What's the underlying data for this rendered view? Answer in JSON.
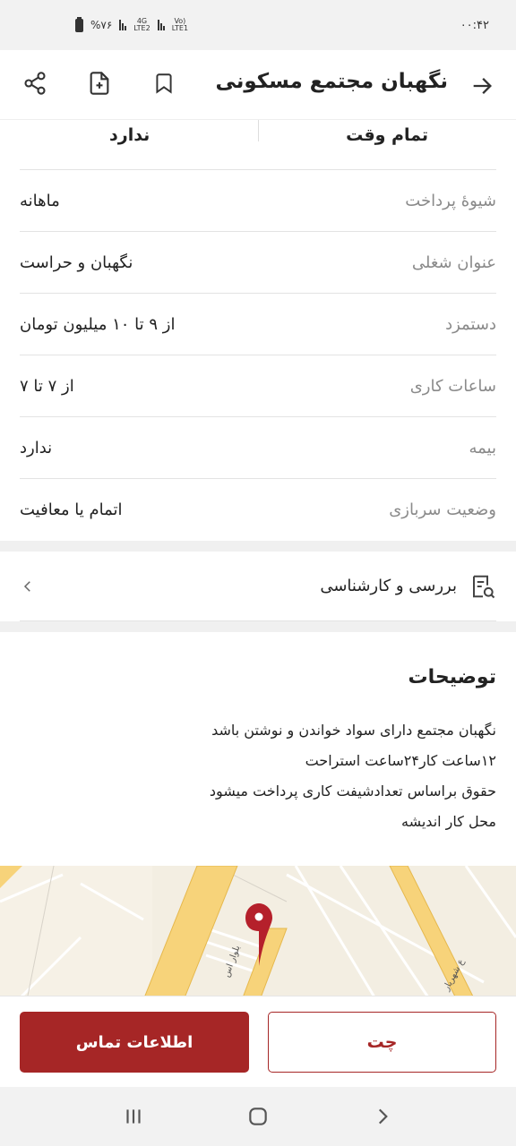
{
  "status_bar": {
    "time": "۰۰:۴۲",
    "battery": "%۷۶",
    "network_1": "4G",
    "network_1_sub": "LTE2",
    "network_2": "Vo)",
    "network_2_sub": "LTE1"
  },
  "header": {
    "title": "نگهبان مجتمع مسکونی"
  },
  "summary": {
    "right_value": "تمام وقت",
    "left_value": "ندارد"
  },
  "attributes": [
    {
      "label": "شیوهٔ پرداخت",
      "value": "ماهانه"
    },
    {
      "label": "عنوان شغلی",
      "value": "نگهبان و حراست"
    },
    {
      "label": "دستمزد",
      "value": "از ۹ تا ۱۰ میلیون تومان"
    },
    {
      "label": "ساعات کاری",
      "value": "از ۷ تا ۷"
    },
    {
      "label": "بیمه",
      "value": "ندارد"
    },
    {
      "label": "وضعیت سربازی",
      "value": "اتمام یا معافیت"
    }
  ],
  "expert_review": {
    "label": "بررسی و کارشناسی"
  },
  "description": {
    "title": "توضیحات",
    "lines": [
      "نگهبان مجتمع دارای سواد خواندن و نوشتن باشد",
      "۱۲ساعت کار۲۴ساعت استراحت",
      "حقوق براساس تعدادشیفت کاری پرداخت میشود",
      "محل کار اندیشه"
    ]
  },
  "map": {
    "street_label_1": "بلوار اس",
    "street_label_2": "ع شهریار"
  },
  "actions": {
    "contact_label": "اطلاعات تماس",
    "chat_label": "چت"
  },
  "colors": {
    "primary": "#a62626"
  }
}
